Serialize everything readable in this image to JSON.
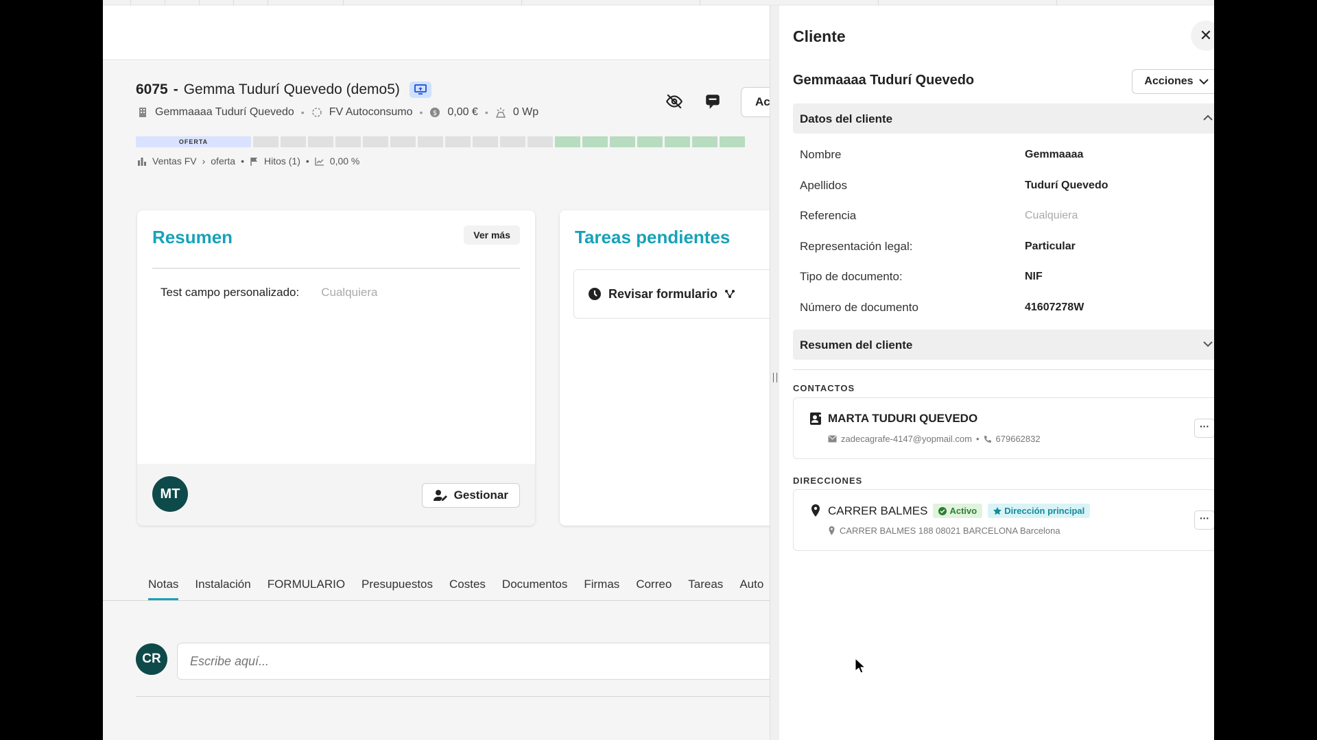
{
  "project": {
    "number": "6075",
    "name": "Gemma Tudurí Quevedo (demo5)",
    "meta": {
      "client": "Gemmaaaa Tudurí Quevedo",
      "type": "FV Autoconsumo",
      "amount": "0,00 €",
      "power": "0 Wp"
    },
    "stage_label": "OFERTA",
    "breadcrumb": {
      "pipeline": "Ventas FV",
      "stage": "oferta",
      "hitos": "Hitos (1)",
      "percent": "0,00 %"
    },
    "action_button_label": "Ac"
  },
  "resumen": {
    "title": "Resumen",
    "ver_mas": "Ver más",
    "field_label": "Test campo personalizado:",
    "field_value": "Cualquiera",
    "avatar_initials": "MT",
    "gestionar": "Gestionar"
  },
  "tareas": {
    "title": "Tareas pendientes",
    "item": "Revisar formulario"
  },
  "tabs": [
    "Notas",
    "Instalación",
    "FORMULARIO",
    "Presupuestos",
    "Costes",
    "Documentos",
    "Firmas",
    "Correo",
    "Tareas",
    "Auto"
  ],
  "notes": {
    "avatar_initials": "CR",
    "placeholder": "Escribe aquí..."
  },
  "panel": {
    "title": "Cliente",
    "client_name": "Gemmaaaa Tudurí Quevedo",
    "acciones": "Acciones",
    "datos_title": "Datos del cliente",
    "fields": [
      {
        "label": "Nombre",
        "value": "Gemmaaaa"
      },
      {
        "label": "Apellidos",
        "value": "Tudurí Quevedo"
      },
      {
        "label": "Referencia",
        "value": "Cualquiera"
      },
      {
        "label": "Representación legal:",
        "value": "Particular"
      },
      {
        "label": "Tipo de documento:",
        "value": "NIF"
      },
      {
        "label": "Número de documento",
        "value": "41607278W"
      }
    ],
    "resumen_title": "Resumen del cliente",
    "contactos_label": "CONTACTOS",
    "contact": {
      "name": "MARTA TUDURI QUEVEDO",
      "email": "zadecagrafe-4147@yopmail.com",
      "phone": "679662832"
    },
    "direcciones_label": "DIRECCIONES",
    "address": {
      "name": "CARRER BALMES",
      "badge_active": "Activo",
      "badge_main": "Dirección principal",
      "full": "CARRER BALMES 188 08021 BARCELONA Barcelona"
    }
  },
  "colors": {
    "accent": "#17a2b8",
    "avatar": "#0f4a4a",
    "stage_first": "#d9e3ff",
    "stage_green": "#b8dcbf"
  }
}
